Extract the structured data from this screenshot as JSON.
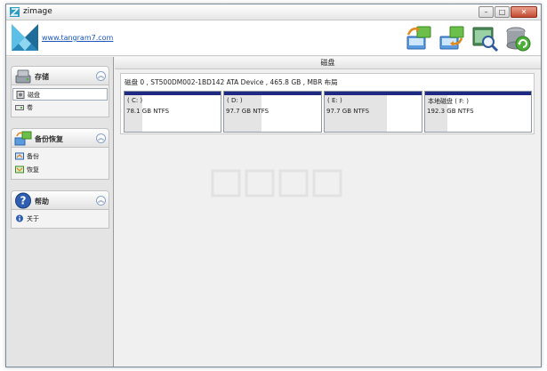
{
  "window": {
    "title": "zimage"
  },
  "header": {
    "link": "www.tangram7.com"
  },
  "toolbar": {
    "buttons": [
      {
        "icon": "backup-tool-icon"
      },
      {
        "icon": "restore-tool-icon"
      },
      {
        "icon": "browse-image-icon"
      },
      {
        "icon": "refresh-disk-icon"
      }
    ]
  },
  "sidebar": {
    "storage": {
      "title": "存储",
      "items": [
        {
          "label": "磁盘"
        },
        {
          "label": "卷"
        }
      ]
    },
    "backup": {
      "title": "备份恢复",
      "items": [
        {
          "label": "备份"
        },
        {
          "label": "恢复"
        }
      ]
    },
    "help": {
      "title": "帮助",
      "items": [
        {
          "label": "关于"
        }
      ]
    }
  },
  "main": {
    "title": "磁盘",
    "disk": {
      "info": "磁盘 0 , ST500DM002-1BD142 ATA Device , 465.8 GB , MBR 布局",
      "partitions": [
        {
          "label": "( C: )",
          "size": "78.1 GB NTFS"
        },
        {
          "label": "( D: )",
          "size": "97.7 GB NTFS"
        },
        {
          "label": "( E: )",
          "size": "97.7 GB NTFS"
        },
        {
          "label": "本地磁盘 ( F: )",
          "size": "192.3 GB NTFS"
        }
      ]
    }
  },
  "colors": {
    "partition_bar": "#1d2a82",
    "link": "#1a55c0"
  }
}
